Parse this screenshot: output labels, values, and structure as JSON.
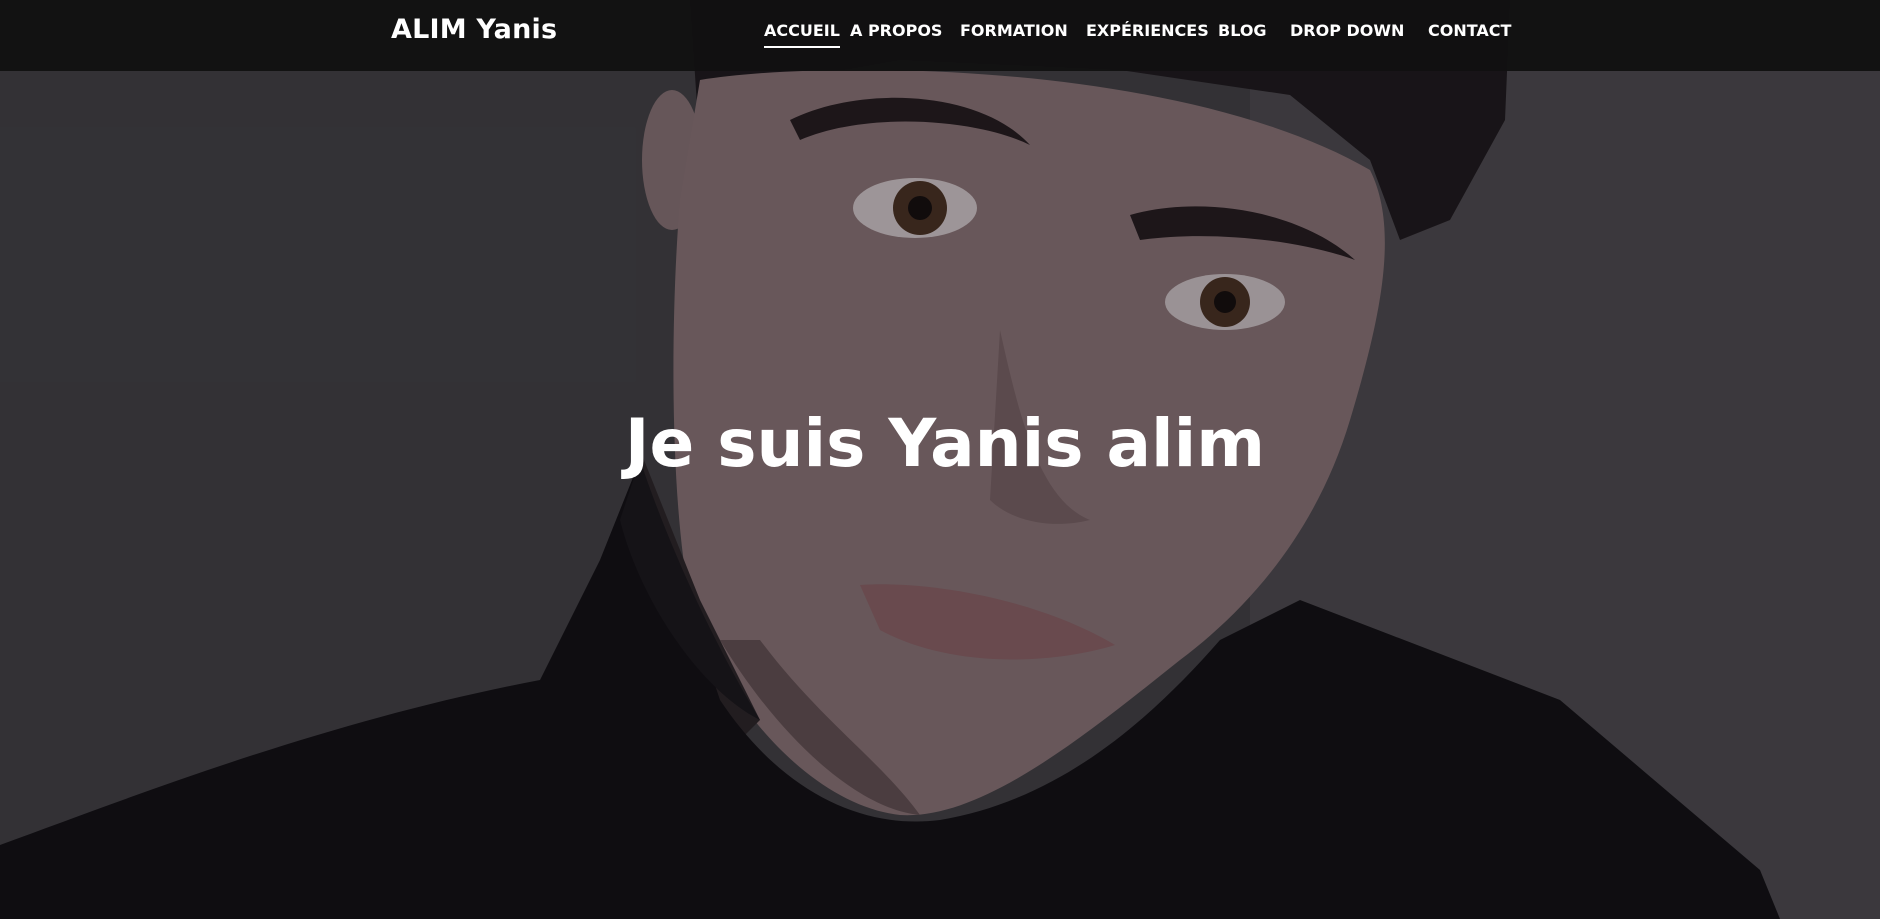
{
  "header": {
    "brand": "ALIM Yanis",
    "nav": [
      {
        "label": "ACCUEIL",
        "active": true
      },
      {
        "label": "A PROPOS",
        "active": false
      },
      {
        "label": "FORMATION",
        "active": false
      },
      {
        "label": "EXPÉRIENCES",
        "active": false
      },
      {
        "label": "BLOG",
        "active": false
      },
      {
        "label": "DROP DOWN",
        "active": false
      },
      {
        "label": "CONTACT",
        "active": false
      }
    ]
  },
  "hero": {
    "headline": "Je suis Yanis alim"
  },
  "colors": {
    "navbar_bg": "#111111",
    "text": "#ffffff"
  }
}
